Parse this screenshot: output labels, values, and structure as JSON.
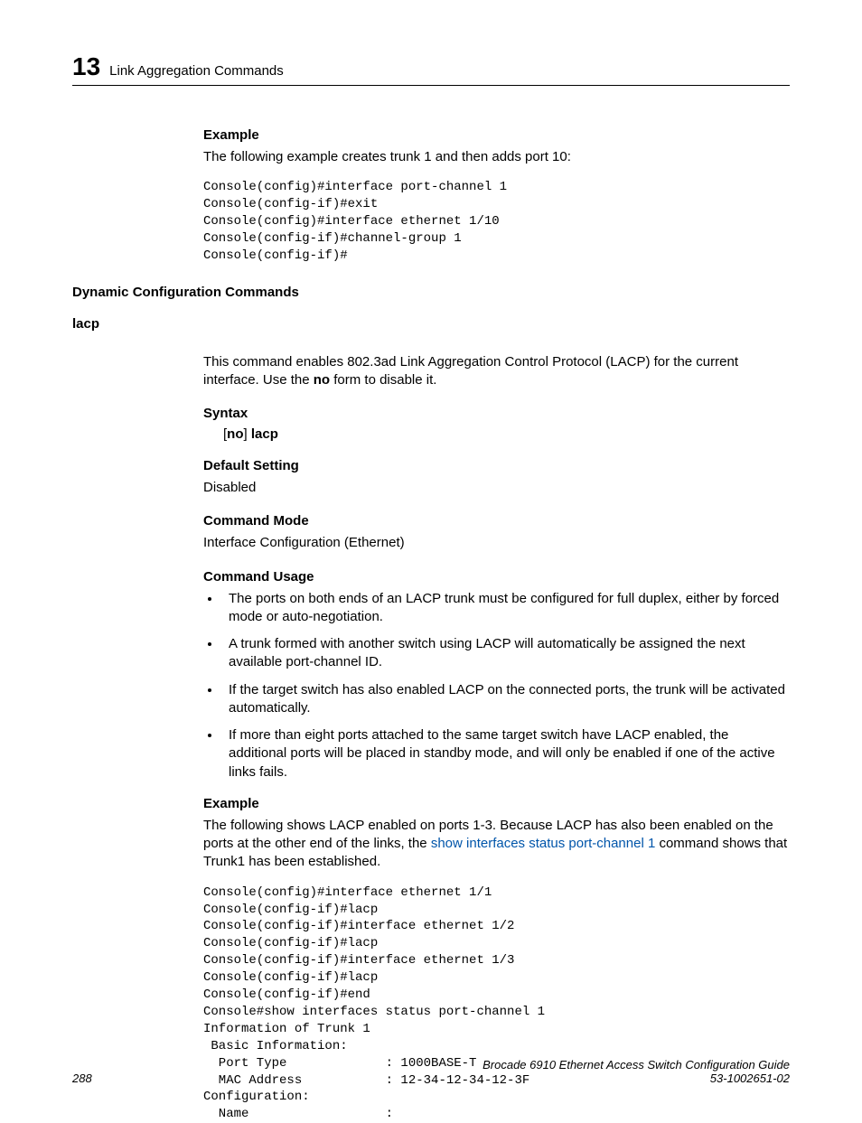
{
  "header": {
    "chapter_num": "13",
    "chapter_title": "Link Aggregation Commands"
  },
  "sections": {
    "example1_heading": "Example",
    "example1_desc": "The following example creates trunk 1 and then adds port 10:",
    "code1": "Console(config)#interface port-channel 1\nConsole(config-if)#exit\nConsole(config)#interface ethernet 1/10\nConsole(config-if)#channel-group 1\nConsole(config-if)#",
    "dyn_heading": "Dynamic Configuration Commands",
    "lacp_heading": "lacp",
    "lacp_desc1": "This command enables 802.3ad Link Aggregation Control Protocol (LACP) for the current interface. Use the ",
    "lacp_desc_no": "no",
    "lacp_desc2": " form to disable it.",
    "syntax_heading": "Syntax",
    "syntax_bracket_open": "[",
    "syntax_no": "no",
    "syntax_bracket_close": "] ",
    "syntax_cmd": "lacp",
    "default_heading": "Default Setting",
    "default_value": "Disabled",
    "mode_heading": "Command Mode",
    "mode_value": "Interface Configuration (Ethernet)",
    "usage_heading": "Command Usage",
    "usage_items": [
      "The ports on both ends of an LACP trunk must be configured for full duplex, either by forced mode or auto-negotiation.",
      "A trunk formed with another switch using LACP will automatically be assigned the next available port-channel ID.",
      "If the target switch has also enabled LACP on the connected ports, the trunk will be activated automatically.",
      "If more than eight ports attached to the same target switch have LACP enabled, the additional ports will be placed in standby mode, and will only be enabled if one of the active links fails."
    ],
    "example2_heading": "Example",
    "example2_desc_a": "The following shows LACP enabled on ports 1-3. Because LACP has also been enabled on the ports at the other end of the links, the ",
    "example2_link": "show interfaces status port-channel 1",
    "example2_desc_b": " command shows that Trunk1 has been established.",
    "code2": "Console(config)#interface ethernet 1/1\nConsole(config-if)#lacp\nConsole(config-if)#interface ethernet 1/2\nConsole(config-if)#lacp\nConsole(config-if)#interface ethernet 1/3\nConsole(config-if)#lacp\nConsole(config-if)#end\nConsole#show interfaces status port-channel 1 \nInformation of Trunk 1\n Basic Information: \n  Port Type             : 1000BASE-T\n  MAC Address           : 12-34-12-34-12-3F\nConfiguration: \n  Name                  :"
  },
  "footer": {
    "page_num": "288",
    "doc_title": "Brocade 6910 Ethernet Access Switch Configuration Guide",
    "doc_id": "53-1002651-02"
  }
}
